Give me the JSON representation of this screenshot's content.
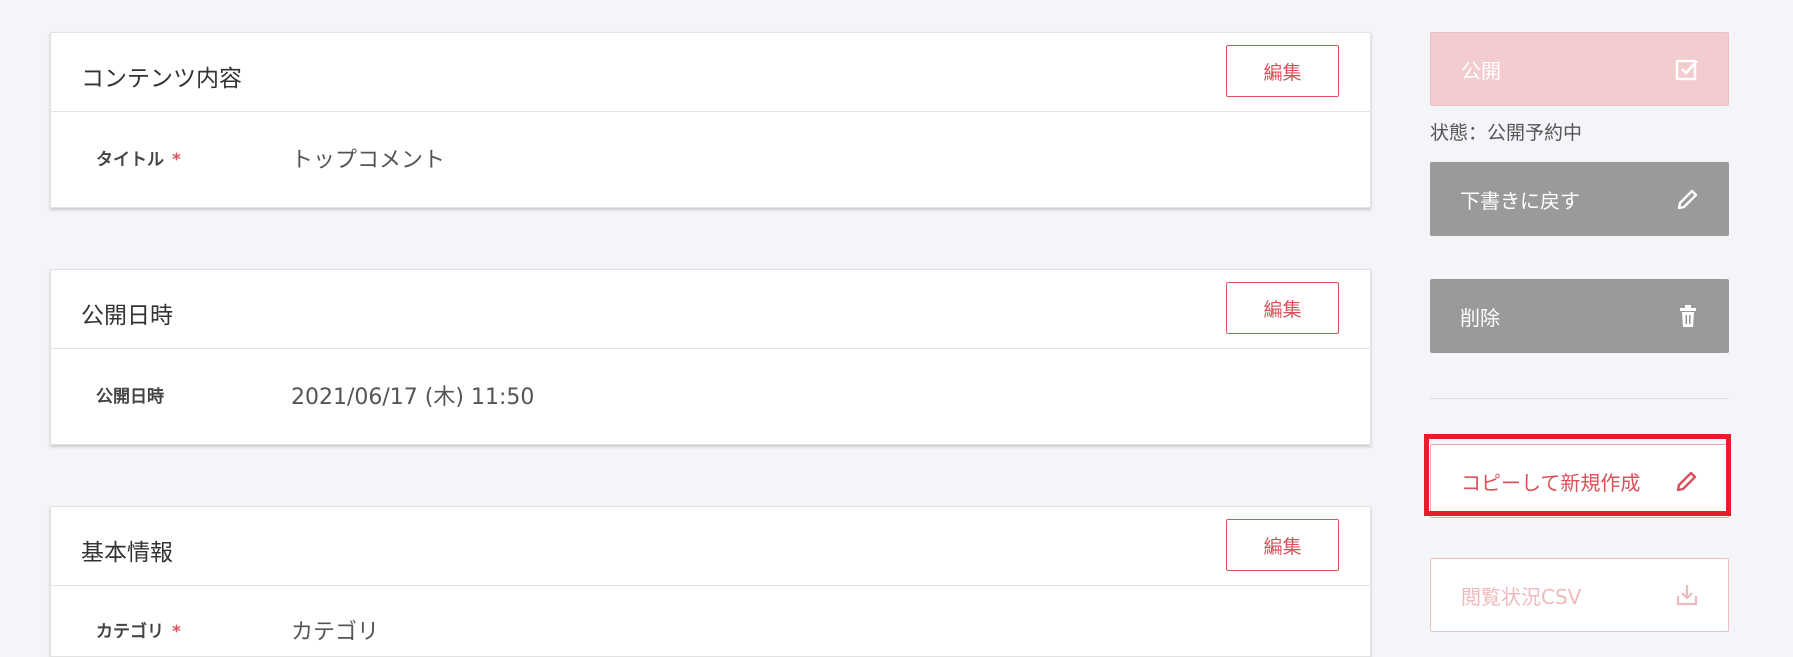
{
  "cards": [
    {
      "title": "コンテンツ内容",
      "edit_label": "編集",
      "field_label": "タイトル",
      "required_mark": "*",
      "field_value": "トップコメント"
    },
    {
      "title": "公開日時",
      "edit_label": "編集",
      "field_label": "公開日時",
      "required_mark": "",
      "field_value": "2021/06/17 (木) 11:50"
    },
    {
      "title": "基本情報",
      "edit_label": "編集",
      "field_label": "カテゴリ",
      "required_mark": "*",
      "field_value": "カテゴリ"
    }
  ],
  "sidebar": {
    "publish_label": "公開",
    "status_text": "状態：公開予約中",
    "revert_label": "下書きに戻す",
    "delete_label": "削除",
    "copy_label": "コピーして新規作成",
    "csv_label": "閲覧状況CSV",
    "icons": {
      "publish": "checkbox-icon",
      "revert": "pencil-icon",
      "delete": "trash-icon",
      "copy": "pencil-icon",
      "csv": "download-icon"
    }
  },
  "colors": {
    "accent": "#d9515a",
    "gray_button": "#9a9a9a",
    "highlight": "#e41e2b",
    "background": "#f4f5f8"
  }
}
